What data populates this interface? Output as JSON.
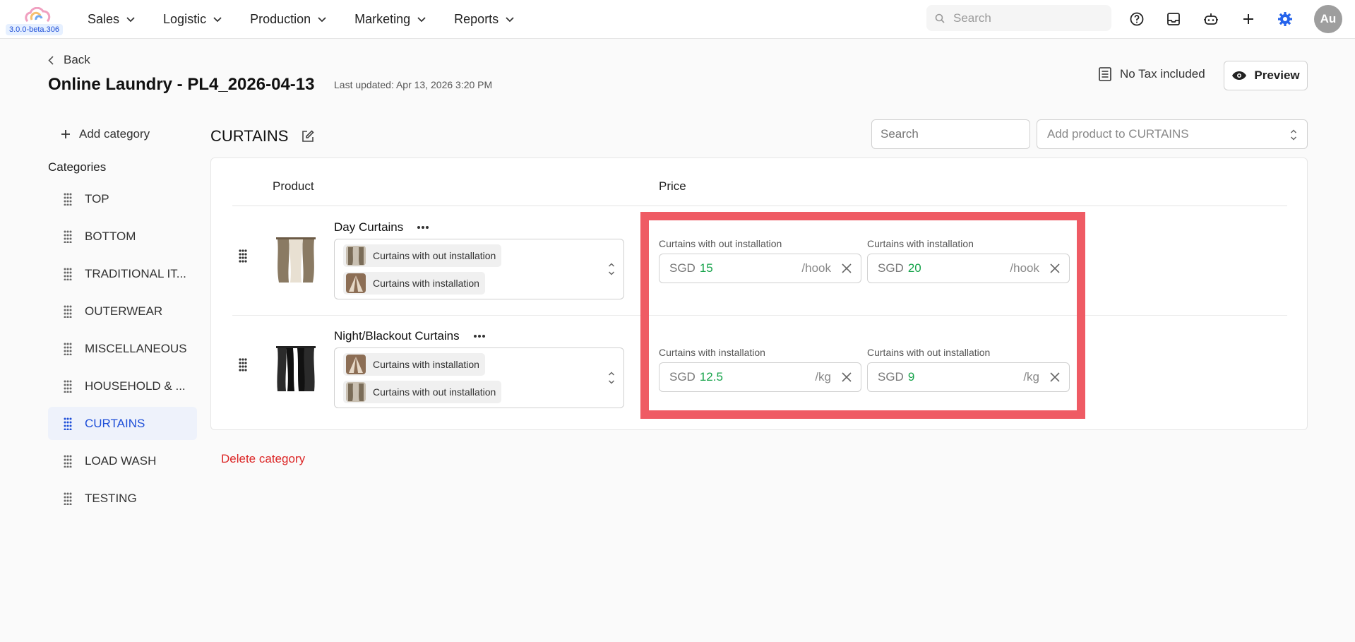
{
  "app": {
    "version": "3.0.0-beta.306",
    "nav": [
      "Sales",
      "Logistic",
      "Production",
      "Marketing",
      "Reports"
    ],
    "search_placeholder": "Search",
    "avatar": "Au"
  },
  "header": {
    "back_label": "Back",
    "title": "Online Laundry - PL4_2026-04-13",
    "last_updated": "Last updated: Apr 13, 2026 3:20 PM",
    "tax_label": "No Tax included",
    "preview_label": "Preview"
  },
  "sidebar": {
    "add_category": "Add category",
    "heading": "Categories",
    "categories": [
      "TOP",
      "BOTTOM",
      "TRADITIONAL IT...",
      "OUTERWEAR",
      "MISCELLANEOUS",
      "HOUSEHOLD & ...",
      "CURTAINS",
      "LOAD WASH",
      "TESTING"
    ],
    "active": "CURTAINS"
  },
  "main": {
    "category_title": "CURTAINS",
    "search_placeholder": "Search",
    "add_product_placeholder": "Add product to CURTAINS",
    "columns": {
      "product": "Product",
      "price": "Price"
    },
    "delete_category": "Delete category",
    "products": [
      {
        "name": "Day Curtains",
        "options": [
          "Curtains with out installation",
          "Curtains with installation"
        ],
        "prices": [
          {
            "label": "Curtains with out installation",
            "currency": "SGD",
            "value": "15",
            "unit": "/hook"
          },
          {
            "label": "Curtains with installation",
            "currency": "SGD",
            "value": "20",
            "unit": "/hook"
          }
        ]
      },
      {
        "name": "Night/Blackout Curtains",
        "options": [
          "Curtains with installation",
          "Curtains with out installation"
        ],
        "prices": [
          {
            "label": "Curtains with installation",
            "currency": "SGD",
            "value": "12.5",
            "unit": "/kg"
          },
          {
            "label": "Curtains with out installation",
            "currency": "SGD",
            "value": "9",
            "unit": "/kg"
          }
        ]
      }
    ]
  },
  "colors": {
    "accent": "#1d4ed8",
    "price_value": "#16a34a",
    "delete": "#dc2626",
    "highlight": "#ef5b64"
  }
}
